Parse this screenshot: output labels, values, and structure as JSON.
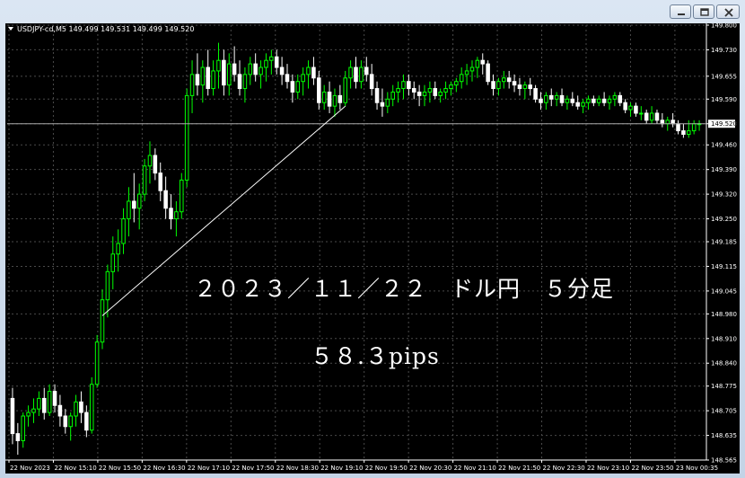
{
  "window": {
    "buttons": {
      "minimize": "minimize-icon",
      "restore": "restore-icon",
      "close": "close-icon"
    }
  },
  "colors": {
    "background": "#000000",
    "grid": "#4a4a4a",
    "bull": "#00ff00",
    "bear": "#ffffff",
    "bid_line": "#aaaaaa"
  },
  "chart": {
    "symbol_header": "USDJPY-cd,M5  149.499 149.531 149.499 149.520",
    "current_price": "149.520",
    "annotation_line1": "２０２３／１１／２２　ドル円　５分足",
    "annotation_line2": "５８.３pips",
    "price_labels": [
      "149.800",
      "149.730",
      "149.655",
      "149.590",
      "149.520",
      "149.460",
      "149.390",
      "149.320",
      "149.250",
      "149.185",
      "149.115",
      "149.045",
      "148.980",
      "148.910",
      "148.840",
      "148.775",
      "148.705",
      "148.635",
      "148.565"
    ],
    "time_labels": [
      "22 Nov 2023",
      "22 Nov 15:10",
      "22 Nov 15:50",
      "22 Nov 16:30",
      "22 Nov 17:10",
      "22 Nov 17:50",
      "22 Nov 18:30",
      "22 Nov 19:10",
      "22 Nov 19:50",
      "22 Nov 20:30",
      "22 Nov 21:10",
      "22 Nov 21:50",
      "22 Nov 22:30",
      "22 Nov 23:10",
      "22 Nov 23:50",
      "23 Nov 00:35"
    ]
  },
  "chart_data": {
    "type": "candlestick",
    "timeframe": "M5",
    "ylim": [
      148.565,
      149.8
    ],
    "trendline": {
      "from": {
        "index": 17,
        "price": 148.975
      },
      "to": {
        "index": 63,
        "price": 149.57
      }
    },
    "candles": [
      [
        148.74,
        148.77,
        148.61,
        148.64
      ],
      [
        148.64,
        148.67,
        148.58,
        148.62
      ],
      [
        148.62,
        148.7,
        148.6,
        148.69
      ],
      [
        148.69,
        148.72,
        148.66,
        148.7
      ],
      [
        148.7,
        148.74,
        148.67,
        148.71
      ],
      [
        148.71,
        148.76,
        148.69,
        148.74
      ],
      [
        148.74,
        148.77,
        148.68,
        148.7
      ],
      [
        148.7,
        148.78,
        148.69,
        148.76
      ],
      [
        148.76,
        148.78,
        148.7,
        148.72
      ],
      [
        148.72,
        148.75,
        148.66,
        148.69
      ],
      [
        148.69,
        148.71,
        148.64,
        148.66
      ],
      [
        148.66,
        148.7,
        148.62,
        148.69
      ],
      [
        148.69,
        148.75,
        148.66,
        148.73
      ],
      [
        148.73,
        148.76,
        148.67,
        148.7
      ],
      [
        148.7,
        148.72,
        148.63,
        148.65
      ],
      [
        148.65,
        148.8,
        148.64,
        148.78
      ],
      [
        148.78,
        148.92,
        148.77,
        148.9
      ],
      [
        148.9,
        149.05,
        148.88,
        149.02
      ],
      [
        149.02,
        149.12,
        148.97,
        149.1
      ],
      [
        149.1,
        149.2,
        149.05,
        149.15
      ],
      [
        149.15,
        149.22,
        149.1,
        149.18
      ],
      [
        149.18,
        149.28,
        149.15,
        149.25
      ],
      [
        149.25,
        149.34,
        149.2,
        149.3
      ],
      [
        149.3,
        149.38,
        149.24,
        149.28
      ],
      [
        149.28,
        149.35,
        149.22,
        149.32
      ],
      [
        149.32,
        149.42,
        149.3,
        149.4
      ],
      [
        149.4,
        149.47,
        149.35,
        149.43
      ],
      [
        149.43,
        149.45,
        149.36,
        149.38
      ],
      [
        149.38,
        149.41,
        149.3,
        149.33
      ],
      [
        149.33,
        149.37,
        149.25,
        149.28
      ],
      [
        149.28,
        149.32,
        149.22,
        149.25
      ],
      [
        149.25,
        149.3,
        149.2,
        149.27
      ],
      [
        149.27,
        149.38,
        149.25,
        149.36
      ],
      [
        149.36,
        149.62,
        149.34,
        149.6
      ],
      [
        149.6,
        149.7,
        149.55,
        149.66
      ],
      [
        149.66,
        149.72,
        149.6,
        149.63
      ],
      [
        149.63,
        149.7,
        149.58,
        149.68
      ],
      [
        149.68,
        149.73,
        149.6,
        149.62
      ],
      [
        149.62,
        149.7,
        149.6,
        149.67
      ],
      [
        149.67,
        149.75,
        149.62,
        149.7
      ],
      [
        149.7,
        149.73,
        149.6,
        149.63
      ],
      [
        149.63,
        149.72,
        149.6,
        149.69
      ],
      [
        149.69,
        149.74,
        149.64,
        149.66
      ],
      [
        149.66,
        149.7,
        149.6,
        149.62
      ],
      [
        149.62,
        149.68,
        149.58,
        149.66
      ],
      [
        149.66,
        149.71,
        149.63,
        149.69
      ],
      [
        149.69,
        149.72,
        149.64,
        149.66
      ],
      [
        149.66,
        149.7,
        149.62,
        149.68
      ],
      [
        149.68,
        149.72,
        149.64,
        149.7
      ],
      [
        149.7,
        149.73,
        149.66,
        149.71
      ],
      [
        149.71,
        149.73,
        149.66,
        149.68
      ],
      [
        149.68,
        149.71,
        149.63,
        149.66
      ],
      [
        149.66,
        149.69,
        149.62,
        149.64
      ],
      [
        149.64,
        149.66,
        149.58,
        149.61
      ],
      [
        149.61,
        149.66,
        149.59,
        149.64
      ],
      [
        149.64,
        149.68,
        149.6,
        149.66
      ],
      [
        149.66,
        149.7,
        149.62,
        149.68
      ],
      [
        149.68,
        149.71,
        149.63,
        149.65
      ],
      [
        149.65,
        149.67,
        149.56,
        149.58
      ],
      [
        149.58,
        149.63,
        149.56,
        149.61
      ],
      [
        149.61,
        149.64,
        149.55,
        149.57
      ],
      [
        149.57,
        149.62,
        149.54,
        149.6
      ],
      [
        149.6,
        149.63,
        149.56,
        149.58
      ],
      [
        149.58,
        149.67,
        149.57,
        149.65
      ],
      [
        149.65,
        149.7,
        149.62,
        149.68
      ],
      [
        149.68,
        149.71,
        149.62,
        149.64
      ],
      [
        149.64,
        149.7,
        149.62,
        149.68
      ],
      [
        149.68,
        149.71,
        149.64,
        149.66
      ],
      [
        149.66,
        149.69,
        149.6,
        149.62
      ],
      [
        149.62,
        149.64,
        149.56,
        149.58
      ],
      [
        149.58,
        149.62,
        149.54,
        149.57
      ],
      [
        149.57,
        149.61,
        149.55,
        149.59
      ],
      [
        149.59,
        149.63,
        149.57,
        149.61
      ],
      [
        149.61,
        149.64,
        149.58,
        149.62
      ],
      [
        149.62,
        149.66,
        149.59,
        149.64
      ],
      [
        149.64,
        149.66,
        149.6,
        149.62
      ],
      [
        149.62,
        149.64,
        149.59,
        149.61
      ],
      [
        149.61,
        149.63,
        149.57,
        149.6
      ],
      [
        149.6,
        149.63,
        149.57,
        149.61
      ],
      [
        149.61,
        149.64,
        149.58,
        149.62
      ],
      [
        149.62,
        149.64,
        149.59,
        149.6
      ],
      [
        149.6,
        149.62,
        149.58,
        149.61
      ],
      [
        149.61,
        149.64,
        149.59,
        149.62
      ],
      [
        149.62,
        149.64,
        149.6,
        149.63
      ],
      [
        149.63,
        149.65,
        149.61,
        149.64
      ],
      [
        149.64,
        149.68,
        149.62,
        149.66
      ],
      [
        149.66,
        149.69,
        149.63,
        149.67
      ],
      [
        149.67,
        149.7,
        149.64,
        149.68
      ],
      [
        149.68,
        149.71,
        149.65,
        149.7
      ],
      [
        149.7,
        149.72,
        149.66,
        149.69
      ],
      [
        149.69,
        149.7,
        149.63,
        149.64
      ],
      [
        149.64,
        149.66,
        149.6,
        149.62
      ],
      [
        149.62,
        149.65,
        149.6,
        149.64
      ],
      [
        149.64,
        149.67,
        149.62,
        149.65
      ],
      [
        149.65,
        149.67,
        149.62,
        149.64
      ],
      [
        149.64,
        149.66,
        149.61,
        149.63
      ],
      [
        149.63,
        149.65,
        149.6,
        149.62
      ],
      [
        149.62,
        149.64,
        149.59,
        149.63
      ],
      [
        149.63,
        149.65,
        149.6,
        149.62
      ],
      [
        149.62,
        149.63,
        149.58,
        149.59
      ],
      [
        149.59,
        149.61,
        149.56,
        149.58
      ],
      [
        149.58,
        149.61,
        149.56,
        149.6
      ],
      [
        149.6,
        149.62,
        149.57,
        149.59
      ],
      [
        149.59,
        149.61,
        149.57,
        149.6
      ],
      [
        149.6,
        149.62,
        149.57,
        149.58
      ],
      [
        149.58,
        149.6,
        149.56,
        149.59
      ],
      [
        149.59,
        149.61,
        149.57,
        149.58
      ],
      [
        149.58,
        149.6,
        149.56,
        149.57
      ],
      [
        149.57,
        149.59,
        149.55,
        149.58
      ],
      [
        149.58,
        149.6,
        149.56,
        149.59
      ],
      [
        149.59,
        149.6,
        149.57,
        149.58
      ],
      [
        149.58,
        149.6,
        149.57,
        149.59
      ],
      [
        149.59,
        149.61,
        149.57,
        149.58
      ],
      [
        149.58,
        149.6,
        149.56,
        149.59
      ],
      [
        149.59,
        149.61,
        149.57,
        149.6
      ],
      [
        149.6,
        149.61,
        149.57,
        149.58
      ],
      [
        149.58,
        149.59,
        149.55,
        149.56
      ],
      [
        149.56,
        149.58,
        149.54,
        149.57
      ],
      [
        149.57,
        149.58,
        149.54,
        149.55
      ],
      [
        149.55,
        149.57,
        149.53,
        149.55
      ],
      [
        149.55,
        149.56,
        149.52,
        149.53
      ],
      [
        149.53,
        149.57,
        149.52,
        149.55
      ],
      [
        149.55,
        149.56,
        149.52,
        149.53
      ],
      [
        149.53,
        149.55,
        149.51,
        149.52
      ],
      [
        149.52,
        149.54,
        149.5,
        149.53
      ],
      [
        149.53,
        149.55,
        149.51,
        149.52
      ],
      [
        149.52,
        149.53,
        149.49,
        149.5
      ],
      [
        149.5,
        149.52,
        149.48,
        149.49
      ],
      [
        149.49,
        149.53,
        149.48,
        149.5
      ],
      [
        149.5,
        149.53,
        149.49,
        149.52
      ],
      [
        149.52,
        149.53,
        149.5,
        149.52
      ]
    ]
  }
}
